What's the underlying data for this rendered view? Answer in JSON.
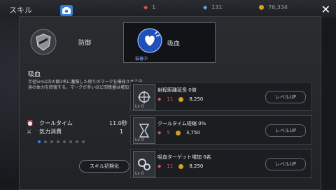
{
  "header": {
    "title": "スキル",
    "resource_1": "1",
    "resource_2": "131",
    "gold": "76,334"
  },
  "tabs": [
    {
      "label": "防御"
    },
    {
      "label": "吸血",
      "status": "装着中"
    }
  ],
  "skill": {
    "name": "吸血",
    "description": "半径5m以内の敵3名に蓄積した怒りのマークを爆発させて自身の体力を回復する。マークが多いほど回復量は増加する。"
  },
  "stats": {
    "cooldown_label": "クールタイム",
    "cooldown_value": "11.0秒",
    "cost_label": "気力消費",
    "cost_value": "1"
  },
  "pager": {
    "total": 8,
    "active": 0
  },
  "reset_label": "スキル初期化",
  "upgrades": [
    {
      "name": "射程距離延長 0倍",
      "ruby": "11",
      "gold": "8,250",
      "level": "Lv 0",
      "button": "レベルUP"
    },
    {
      "name": "クールタイム短縮 0%",
      "ruby": "5",
      "gold": "3,750",
      "level": "Lv 0",
      "button": "レベルUP"
    },
    {
      "name": "吸血ターゲット増加 0名",
      "ruby": "11",
      "gold": "8,250",
      "level": "Lv 0",
      "button": "レベルUP"
    }
  ],
  "colors": {
    "accent": "#3b82f6",
    "ruby": "#e25555",
    "gold": "#d6a21c"
  }
}
